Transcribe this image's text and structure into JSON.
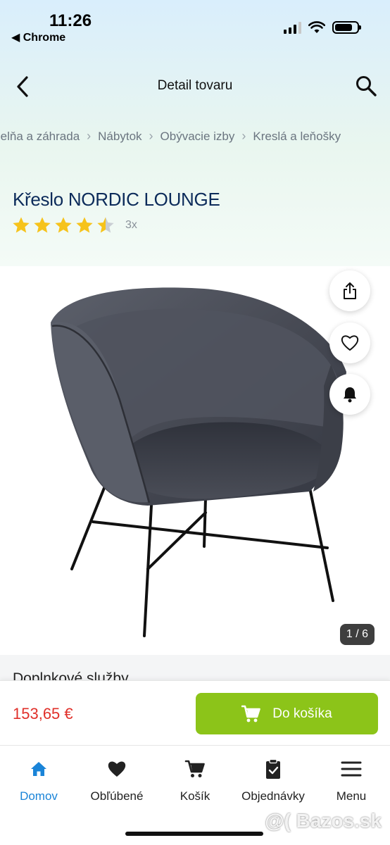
{
  "status_bar": {
    "time": "11:26",
    "back_app": "◀ Chrome"
  },
  "nav": {
    "title": "Detail tovaru"
  },
  "breadcrumb": [
    ", dielňa a záhrada",
    "Nábytok",
    "Obývacie izby",
    "Kreslá a leňošky"
  ],
  "product": {
    "title": "Křeslo NORDIC LOUNGE",
    "rating_count": "3x",
    "rating_value": 4.5,
    "image_counter": "1 / 6"
  },
  "services": {
    "label": "Doplnkové služby"
  },
  "purchase": {
    "price": "153,65 €",
    "cart_button": "Do košíka"
  },
  "tabs": [
    {
      "label": "Domov",
      "icon": "home-icon",
      "active": true
    },
    {
      "label": "Obľúbené",
      "icon": "heart-icon",
      "active": false
    },
    {
      "label": "Košík",
      "icon": "cart-icon",
      "active": false
    },
    {
      "label": "Objednávky",
      "icon": "orders-clipboard-icon",
      "active": false
    },
    {
      "label": "Menu",
      "icon": "hamburger-menu-icon",
      "active": false
    }
  ],
  "watermark": "@( Bazos.sk",
  "colors": {
    "accent_green": "#8cc419",
    "price_red": "#e0302a",
    "title_navy": "#0c2b5a",
    "active_blue": "#1a84d8",
    "star": "#f6c31b"
  }
}
